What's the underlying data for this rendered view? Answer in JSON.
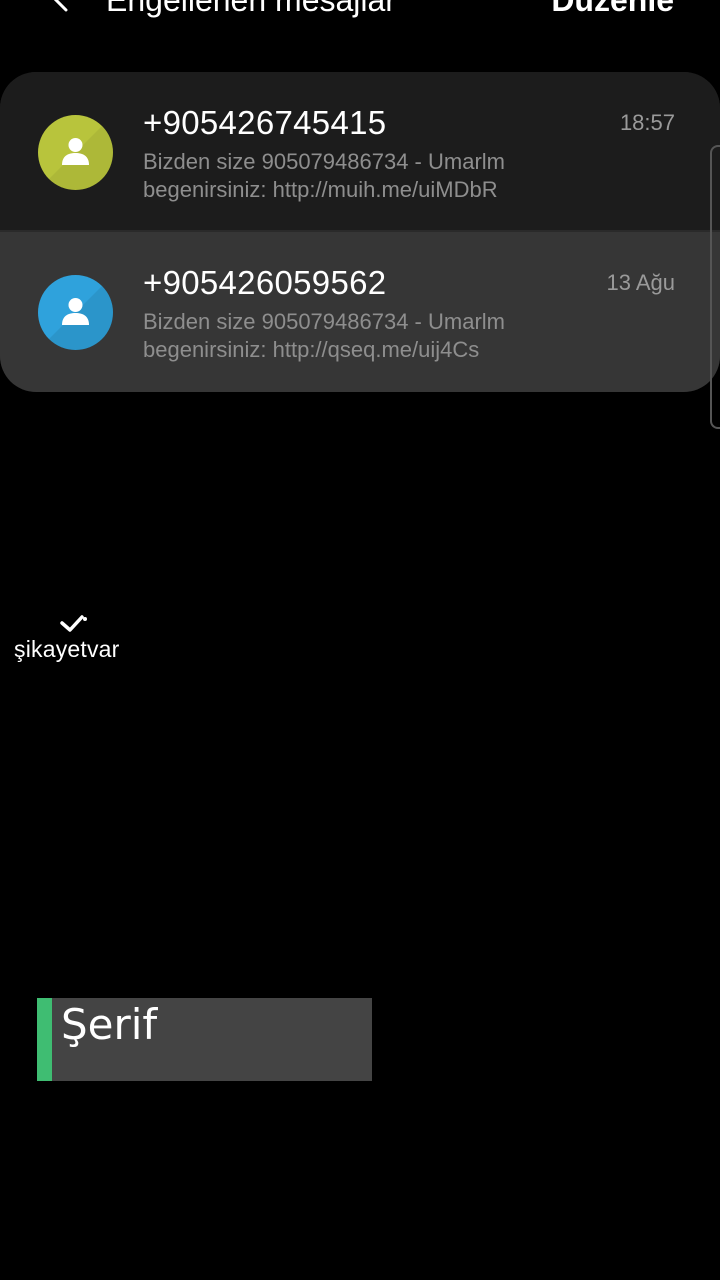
{
  "header": {
    "title": "Engellenen mesajlar",
    "edit_label": "Düzenle"
  },
  "messages": [
    {
      "sender": "+905426745415",
      "time": "18:57",
      "preview_line1": "Bizden size 905079486734 - Umarlm",
      "preview_line2": "begenirsiniz:  http://muih.me/uiMDbR",
      "avatar_color": "#b8c43c"
    },
    {
      "sender": "+905426059562",
      "time": "13 Ağu",
      "preview_line1": "Bizden size 905079486734 - Umarlm",
      "preview_line2": "begenirsiniz:  http://qseq.me/uij4Cs",
      "avatar_color": "#2fa2dc"
    }
  ],
  "watermark": {
    "text": "şikayetvar",
    "icon": "checkmark-logo-icon"
  },
  "caption": {
    "text": "Şerif",
    "accent_color": "#3fbd72"
  }
}
